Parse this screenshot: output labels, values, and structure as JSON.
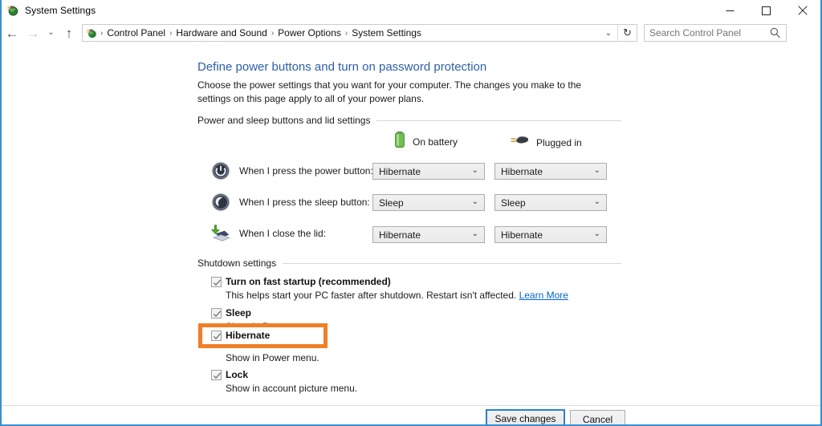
{
  "window": {
    "title": "System Settings",
    "title_icon": "power-options-icon",
    "caption": {
      "minimize": "minimize-icon",
      "maximize": "maximize-icon",
      "close": "close-icon"
    }
  },
  "nav": {
    "back": "back-arrow-icon",
    "forward": "forward-arrow-icon",
    "recent": "recent-locations-chevron-icon",
    "up": "up-arrow-icon",
    "breadcrumb_icon": "control-panel-icon",
    "breadcrumbs": [
      "Control Panel",
      "Hardware and Sound",
      "Power Options",
      "System Settings"
    ],
    "separator": "›",
    "address_chevron": "address-dropdown-chevron",
    "refresh": "refresh-icon"
  },
  "search": {
    "placeholder": "Search Control Panel",
    "value": "",
    "icon": "search-icon"
  },
  "main": {
    "heading": "Define power buttons and turn on password protection",
    "description": "Choose the power settings that you want for your computer. The changes you make to the settings on this page apply to all of your power plans.",
    "section_power": "Power and sleep buttons and lid settings",
    "section_shutdown": "Shutdown settings",
    "columns": [
      {
        "label": "On battery",
        "icon": "battery-icon"
      },
      {
        "label": "Plugged in",
        "icon": "power-plug-icon"
      }
    ],
    "rows": [
      {
        "icon": "power-button-icon",
        "label": "When I press the power button:",
        "on_battery": "Hibernate",
        "plugged_in": "Hibernate"
      },
      {
        "icon": "sleep-button-icon",
        "label": "When I press the sleep button:",
        "on_battery": "Sleep",
        "plugged_in": "Sleep"
      },
      {
        "icon": "laptop-lid-icon",
        "label": "When I close the lid:",
        "on_battery": "Hibernate",
        "plugged_in": "Hibernate"
      }
    ],
    "shutdown_options": [
      {
        "label": "Turn on fast startup (recommended)",
        "checked": true,
        "description": "This helps start your PC faster after shutdown. Restart isn't affected.",
        "link": "Learn More"
      },
      {
        "label": "Sleep",
        "checked": true,
        "description": "Show in Power menu."
      },
      {
        "label": "Hibernate",
        "checked": true,
        "description": "Show in Power menu.",
        "highlighted": true
      },
      {
        "label": "Lock",
        "checked": true,
        "description": "Show in account picture menu."
      }
    ]
  },
  "footer": {
    "save_label": "Save changes",
    "cancel_label": "Cancel"
  },
  "colors": {
    "window_border": "#3a8ed0",
    "heading": "#2c5fa8",
    "link": "#0066cc",
    "annotation": "#ef7f28",
    "primary_button_border": "#2b7fd4"
  }
}
